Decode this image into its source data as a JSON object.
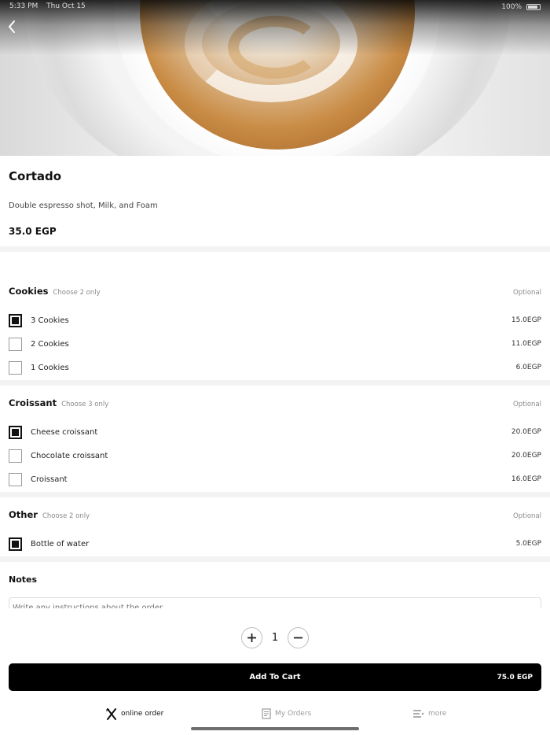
{
  "status_bar": {
    "time": "5:33 PM",
    "date": "Thu Oct 15",
    "battery": "100%"
  },
  "product": {
    "name": "Cortado",
    "description": "Double espresso shot, Milk, and Foam",
    "price": "35.0 EGP"
  },
  "groups": [
    {
      "title": "Cookies",
      "hint": "Choose 2 only",
      "optional": "Optional",
      "options": [
        {
          "label": "3 Cookies",
          "price": "15.0EGP",
          "checked": true
        },
        {
          "label": "2 Cookies",
          "price": "11.0EGP",
          "checked": false
        },
        {
          "label": "1 Cookies",
          "price": "6.0EGP",
          "checked": false
        }
      ]
    },
    {
      "title": "Croissant",
      "hint": "Choose 3 only",
      "optional": "Optional",
      "options": [
        {
          "label": "Cheese croissant",
          "price": "20.0EGP",
          "checked": true
        },
        {
          "label": "Chocolate croissant",
          "price": "20.0EGP",
          "checked": false
        },
        {
          "label": "Croissant",
          "price": "16.0EGP",
          "checked": false
        }
      ]
    },
    {
      "title": "Other",
      "hint": "Choose 2 only",
      "optional": "Optional",
      "options": [
        {
          "label": "Bottle of water",
          "price": "5.0EGP",
          "checked": true
        }
      ]
    }
  ],
  "notes": {
    "title": "Notes",
    "placeholder": "Write any instructions about the order"
  },
  "quantity": {
    "value": "1"
  },
  "cart": {
    "label": "Add To Cart",
    "total": "75.0 EGP"
  },
  "tabs": [
    {
      "label": "online order",
      "icon": "fork-knife-icon",
      "active": true
    },
    {
      "label": "My Orders",
      "icon": "orders-list-icon",
      "active": false
    },
    {
      "label": "more",
      "icon": "menu-lines-icon",
      "active": false
    }
  ],
  "colors": {
    "accent": "#000000",
    "checked": "#111111",
    "muted": "#8a8a8a"
  }
}
